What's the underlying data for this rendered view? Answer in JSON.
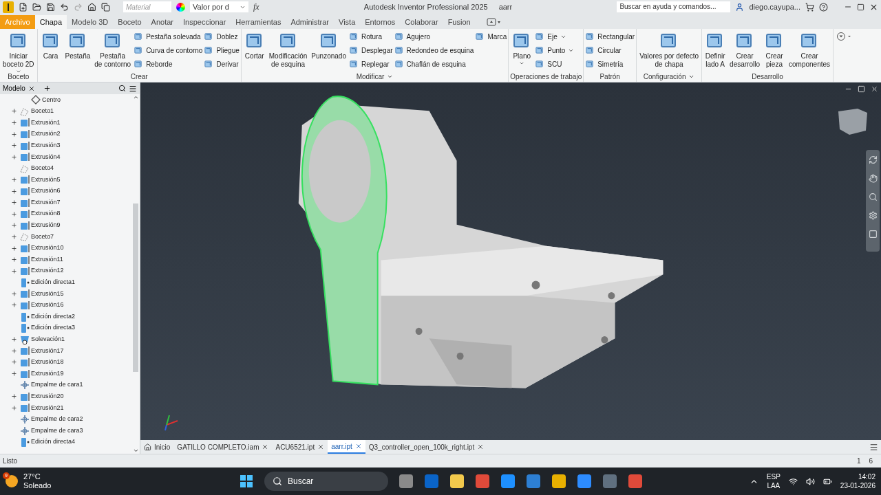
{
  "window": {
    "title": "Autodesk Inventor Professional 2025",
    "document": "aarr"
  },
  "quick_access": {
    "material": {
      "placeholder": "Material"
    },
    "appearance": {
      "value": "Valor por d"
    },
    "formula": "fx"
  },
  "help_search": {
    "placeholder": "Buscar en ayuda y comandos..."
  },
  "user": {
    "name": "diego.cayupa..."
  },
  "tabs": [
    {
      "label": "Archivo",
      "kind": "file",
      "selected": false
    },
    {
      "label": "Chapa",
      "kind": "tab",
      "selected": true
    },
    {
      "label": "Modelo 3D",
      "kind": "tab",
      "selected": false
    },
    {
      "label": "Boceto",
      "kind": "tab",
      "selected": false
    },
    {
      "label": "Anotar",
      "kind": "tab",
      "selected": false
    },
    {
      "label": "Inspeccionar",
      "kind": "tab",
      "selected": false
    },
    {
      "label": "Herramientas",
      "kind": "tab",
      "selected": false
    },
    {
      "label": "Administrar",
      "kind": "tab",
      "selected": false
    },
    {
      "label": "Vista",
      "kind": "tab",
      "selected": false
    },
    {
      "label": "Entornos",
      "kind": "tab",
      "selected": false
    },
    {
      "label": "Colaborar",
      "kind": "tab",
      "selected": false
    },
    {
      "label": "Fusion",
      "kind": "tab",
      "selected": false
    }
  ],
  "ribbon": [
    {
      "title": "Boceto",
      "menu": false,
      "columns": [
        {
          "kind": "large",
          "label": [
            "Iniciar",
            "boceto 2D"
          ],
          "dropdown": true
        }
      ]
    },
    {
      "title": "Crear",
      "menu": false,
      "columns": [
        {
          "kind": "large",
          "label": [
            "Cara"
          ],
          "dropdown": false
        },
        {
          "kind": "large",
          "label": [
            "Pestaña"
          ],
          "dropdown": false
        },
        {
          "kind": "large",
          "label": [
            "Pestaña",
            "de contorno"
          ],
          "dropdown": false
        },
        {
          "kind": "stack",
          "items": [
            {
              "label": "Pestaña solevada",
              "dropdown": false
            },
            {
              "label": "Curva de contorno",
              "dropdown": false
            },
            {
              "label": "Reborde",
              "dropdown": false
            }
          ]
        },
        {
          "kind": "stack",
          "items": [
            {
              "label": "Doblez",
              "dropdown": false
            },
            {
              "label": "Pliegue",
              "dropdown": false
            },
            {
              "label": "Derivar",
              "dropdown": false
            }
          ]
        }
      ]
    },
    {
      "title": "Modificar",
      "menu": true,
      "columns": [
        {
          "kind": "large",
          "label": [
            "Cortar"
          ],
          "dropdown": false
        },
        {
          "kind": "large",
          "label": [
            "Modificación",
            "de esquina"
          ],
          "dropdown": false
        },
        {
          "kind": "large",
          "label": [
            "Punzonado"
          ],
          "dropdown": false
        },
        {
          "kind": "stack",
          "items": [
            {
              "label": "Rotura",
              "dropdown": false
            },
            {
              "label": "Desplegar",
              "dropdown": false
            },
            {
              "label": "Replegar",
              "dropdown": false
            }
          ]
        },
        {
          "kind": "stack",
          "items": [
            {
              "label": "Agujero",
              "dropdown": false
            },
            {
              "label": "Redondeo de esquina",
              "dropdown": false
            },
            {
              "label": "Chaflán de esquina",
              "dropdown": false
            }
          ]
        },
        {
          "kind": "stack",
          "items": [
            {
              "label": "Marca",
              "dropdown": false
            }
          ]
        }
      ]
    },
    {
      "title": "Operaciones de trabajo",
      "menu": false,
      "columns": [
        {
          "kind": "large",
          "label": [
            "Plano"
          ],
          "dropdown": true
        },
        {
          "kind": "stack",
          "items": [
            {
              "label": "Eje",
              "dropdown": true
            },
            {
              "label": "Punto",
              "dropdown": true
            },
            {
              "label": "SCU",
              "dropdown": false
            }
          ]
        }
      ]
    },
    {
      "title": "Patrón",
      "menu": false,
      "columns": [
        {
          "kind": "stack",
          "items": [
            {
              "label": "Rectangular",
              "dropdown": false
            },
            {
              "label": "Circular",
              "dropdown": false
            },
            {
              "label": "Simetría",
              "dropdown": false
            }
          ]
        }
      ]
    },
    {
      "title": "Configuración",
      "menu": true,
      "columns": [
        {
          "kind": "large",
          "label": [
            "Valores por defecto",
            "de chapa"
          ],
          "dropdown": false
        }
      ]
    },
    {
      "title": "Desarrollo",
      "menu": false,
      "columns": [
        {
          "kind": "large",
          "label": [
            "Definir",
            "lado A"
          ],
          "dropdown": false
        },
        {
          "kind": "large",
          "label": [
            "Crear",
            "desarrollo"
          ],
          "dropdown": false
        },
        {
          "kind": "large",
          "label": [
            "Crear",
            "pieza"
          ],
          "dropdown": false
        },
        {
          "kind": "large",
          "label": [
            "Crear",
            "componentes"
          ],
          "dropdown": false
        }
      ]
    }
  ],
  "browser": {
    "tab": "Modelo",
    "items": [
      {
        "label": "Centro",
        "kind": "point",
        "expandable": false
      },
      {
        "label": "Boceto1",
        "kind": "sketch",
        "expandable": true
      },
      {
        "label": "Extrusión1",
        "kind": "extrusion",
        "expandable": true
      },
      {
        "label": "Extrusión2",
        "kind": "extrusion",
        "expandable": true
      },
      {
        "label": "Extrusión3",
        "kind": "extrusion",
        "expandable": true
      },
      {
        "label": "Extrusión4",
        "kind": "extrusion",
        "expandable": true
      },
      {
        "label": "Boceto4",
        "kind": "sketch",
        "expandable": false
      },
      {
        "label": "Extrusión5",
        "kind": "extrusion",
        "expandable": true
      },
      {
        "label": "Extrusión6",
        "kind": "extrusion",
        "expandable": true
      },
      {
        "label": "Extrusión7",
        "kind": "extrusion",
        "expandable": true
      },
      {
        "label": "Extrusión8",
        "kind": "extrusion",
        "expandable": true
      },
      {
        "label": "Extrusión9",
        "kind": "extrusion",
        "expandable": true
      },
      {
        "label": "Boceto7",
        "kind": "sketch",
        "expandable": true
      },
      {
        "label": "Extrusión10",
        "kind": "extrusion",
        "expandable": true
      },
      {
        "label": "Extrusión11",
        "kind": "extrusion",
        "expandable": true
      },
      {
        "label": "Extrusión12",
        "kind": "extrusion",
        "expandable": true
      },
      {
        "label": "Edición directa1",
        "kind": "edit",
        "expandable": false
      },
      {
        "label": "Extrusión15",
        "kind": "extrusion",
        "expandable": true
      },
      {
        "label": "Extrusión16",
        "kind": "extrusion",
        "expandable": true
      },
      {
        "label": "Edición directa2",
        "kind": "edit",
        "expandable": false
      },
      {
        "label": "Edición directa3",
        "kind": "edit",
        "expandable": false
      },
      {
        "label": "Solevación1",
        "kind": "loft",
        "expandable": true
      },
      {
        "label": "Extrusión17",
        "kind": "extrusion",
        "expandable": true
      },
      {
        "label": "Extrusión18",
        "kind": "extrusion",
        "expandable": true
      },
      {
        "label": "Extrusión19",
        "kind": "extrusion",
        "expandable": true
      },
      {
        "label": "Empalme de cara1",
        "kind": "fillet",
        "expandable": false
      },
      {
        "label": "Extrusión20",
        "kind": "extrusion",
        "expandable": true
      },
      {
        "label": "Extrusión21",
        "kind": "extrusion",
        "expandable": true
      },
      {
        "label": "Empalme de cara2",
        "kind": "fillet",
        "expandable": false
      },
      {
        "label": "Empalme de cara3",
        "kind": "fillet",
        "expandable": false
      },
      {
        "label": "Edición directa4",
        "kind": "edit",
        "expandable": false
      }
    ]
  },
  "document_tabs": [
    {
      "label": "Inicio",
      "kind": "home",
      "selected": false
    },
    {
      "label": "GATILLO COMPLETO.iam",
      "kind": "doc",
      "selected": false
    },
    {
      "label": "ACU6521.ipt",
      "kind": "doc",
      "selected": false
    },
    {
      "label": "aarr.ipt",
      "kind": "doc",
      "selected": true
    },
    {
      "label": "Q3_controller_open_100k_right.ipt",
      "kind": "doc",
      "selected": false
    }
  ],
  "status_bar": {
    "text": "Listo",
    "counts": [
      "1",
      "6"
    ]
  },
  "taskbar": {
    "weather": {
      "temp": "27°C",
      "condition": "Soleado",
      "badge": "9"
    },
    "search": "Buscar",
    "language": [
      "ESP",
      "LAA"
    ],
    "time": "14:02",
    "date": "23-01-2026"
  }
}
